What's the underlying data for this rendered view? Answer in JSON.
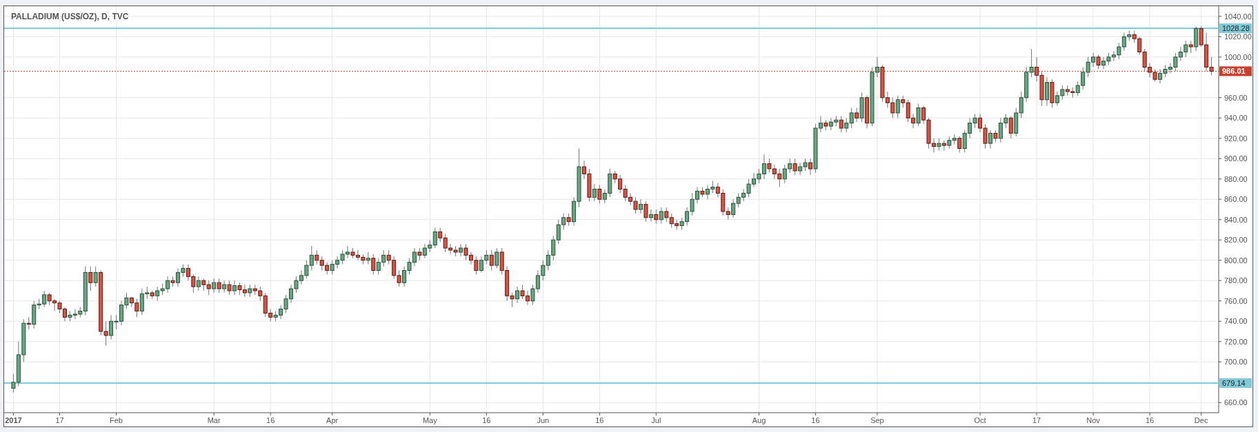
{
  "chart": {
    "chart_data": {
      "type": "candlestick",
      "title": "PALLADIUM (US$/OZ), D, TVC",
      "grid": true,
      "ylim": [
        650,
        1050
      ],
      "yticks": [
        {
          "value": 660,
          "label": "660.00"
        },
        {
          "value": 700,
          "label": "700.00"
        },
        {
          "value": 720,
          "label": "720.00"
        },
        {
          "value": 740,
          "label": "740.00"
        },
        {
          "value": 760,
          "label": "760.00"
        },
        {
          "value": 780,
          "label": "780.00"
        },
        {
          "value": 800,
          "label": "800.00"
        },
        {
          "value": 820,
          "label": "820.00"
        },
        {
          "value": 840,
          "label": "840.00"
        },
        {
          "value": 860,
          "label": "860.00"
        },
        {
          "value": 880,
          "label": "880.00"
        },
        {
          "value": 900,
          "label": "900.00"
        },
        {
          "value": 920,
          "label": "920.00"
        },
        {
          "value": 940,
          "label": "940.00"
        },
        {
          "value": 960,
          "label": "960.00"
        },
        {
          "value": 1000,
          "label": "1000.00"
        },
        {
          "value": 1020,
          "label": "1020.00"
        },
        {
          "value": 1040,
          "label": "1040.00"
        }
      ],
      "categories": [
        "2017",
        null,
        null,
        null,
        null,
        null,
        null,
        null,
        null,
        "17",
        null,
        null,
        null,
        null,
        null,
        null,
        null,
        null,
        null,
        null,
        "Feb",
        null,
        null,
        null,
        null,
        null,
        null,
        null,
        null,
        null,
        null,
        null,
        null,
        null,
        null,
        null,
        null,
        null,
        null,
        "Mar",
        null,
        null,
        null,
        null,
        null,
        null,
        null,
        null,
        null,
        null,
        "16",
        null,
        null,
        null,
        null,
        null,
        null,
        null,
        null,
        null,
        null,
        null,
        "Apr",
        null,
        null,
        null,
        null,
        null,
        null,
        null,
        null,
        null,
        null,
        null,
        null,
        null,
        null,
        null,
        null,
        null,
        null,
        "May",
        null,
        null,
        null,
        null,
        null,
        null,
        null,
        null,
        null,
        null,
        "16",
        null,
        null,
        null,
        null,
        null,
        null,
        null,
        null,
        null,
        null,
        "Jun",
        null,
        null,
        null,
        null,
        null,
        null,
        null,
        null,
        null,
        null,
        "16",
        null,
        null,
        null,
        null,
        null,
        null,
        null,
        null,
        null,
        null,
        "Jul",
        null,
        null,
        null,
        null,
        null,
        null,
        null,
        null,
        null,
        null,
        null,
        null,
        null,
        null,
        null,
        null,
        null,
        null,
        null,
        "Aug",
        null,
        null,
        null,
        null,
        null,
        null,
        null,
        null,
        null,
        null,
        "16",
        null,
        null,
        null,
        null,
        null,
        null,
        null,
        null,
        null,
        null,
        null,
        "Sep",
        null,
        null,
        null,
        null,
        null,
        null,
        null,
        null,
        null,
        null,
        null,
        null,
        null,
        null,
        null,
        null,
        null,
        null,
        null,
        "Oct",
        null,
        null,
        null,
        null,
        null,
        null,
        null,
        null,
        null,
        null,
        "17",
        null,
        null,
        null,
        null,
        null,
        null,
        null,
        null,
        null,
        null,
        "Nov",
        null,
        null,
        null,
        null,
        null,
        null,
        null,
        null,
        null,
        null,
        "16",
        null,
        null,
        null,
        null,
        null,
        null,
        null,
        null,
        null,
        "Dec",
        null,
        null
      ],
      "ohlc": [
        [
          674,
          688,
          670,
          680
        ],
        [
          680,
          720,
          676,
          707
        ],
        [
          707,
          742,
          700,
          738
        ],
        [
          738,
          744,
          732,
          737
        ],
        [
          737,
          760,
          733,
          756
        ],
        [
          756,
          762,
          752,
          757
        ],
        [
          757,
          770,
          754,
          766
        ],
        [
          766,
          768,
          756,
          760
        ],
        [
          760,
          762,
          750,
          758
        ],
        [
          758,
          760,
          748,
          752
        ],
        [
          752,
          754,
          740,
          744
        ],
        [
          744,
          750,
          740,
          746
        ],
        [
          746,
          752,
          742,
          747
        ],
        [
          747,
          754,
          744,
          750
        ],
        [
          750,
          794,
          746,
          788
        ],
        [
          788,
          794,
          770,
          778
        ],
        [
          778,
          794,
          774,
          788
        ],
        [
          788,
          790,
          726,
          730
        ],
        [
          730,
          740,
          716,
          726
        ],
        [
          726,
          746,
          722,
          740
        ],
        [
          740,
          746,
          732,
          740
        ],
        [
          740,
          760,
          736,
          756
        ],
        [
          756,
          768,
          752,
          763
        ],
        [
          763,
          764,
          754,
          758
        ],
        [
          758,
          762,
          744,
          750
        ],
        [
          750,
          772,
          746,
          767
        ],
        [
          767,
          774,
          762,
          768
        ],
        [
          768,
          770,
          762,
          765
        ],
        [
          765,
          774,
          760,
          770
        ],
        [
          770,
          777,
          766,
          772
        ],
        [
          772,
          784,
          768,
          780
        ],
        [
          780,
          784,
          774,
          778
        ],
        [
          778,
          792,
          774,
          788
        ],
        [
          788,
          796,
          784,
          792
        ],
        [
          792,
          796,
          780,
          784
        ],
        [
          784,
          786,
          768,
          774
        ],
        [
          774,
          784,
          770,
          780
        ],
        [
          780,
          782,
          770,
          776
        ],
        [
          776,
          780,
          766,
          772
        ],
        [
          772,
          782,
          768,
          778
        ],
        [
          778,
          782,
          768,
          772
        ],
        [
          772,
          780,
          768,
          776
        ],
        [
          776,
          780,
          766,
          770
        ],
        [
          770,
          780,
          766,
          775
        ],
        [
          775,
          778,
          766,
          771
        ],
        [
          771,
          776,
          764,
          768
        ],
        [
          768,
          776,
          764,
          772
        ],
        [
          772,
          776,
          766,
          770
        ],
        [
          770,
          774,
          760,
          765
        ],
        [
          765,
          768,
          744,
          748
        ],
        [
          748,
          752,
          740,
          744
        ],
        [
          744,
          750,
          740,
          746
        ],
        [
          746,
          756,
          742,
          752
        ],
        [
          752,
          766,
          748,
          762
        ],
        [
          762,
          776,
          758,
          772
        ],
        [
          772,
          784,
          768,
          780
        ],
        [
          780,
          790,
          776,
          785
        ],
        [
          785,
          800,
          782,
          795
        ],
        [
          795,
          814,
          790,
          805
        ],
        [
          805,
          810,
          796,
          800
        ],
        [
          800,
          804,
          790,
          795
        ],
        [
          795,
          798,
          786,
          790
        ],
        [
          790,
          800,
          786,
          796
        ],
        [
          796,
          804,
          792,
          800
        ],
        [
          800,
          810,
          796,
          806
        ],
        [
          806,
          814,
          802,
          808
        ],
        [
          808,
          812,
          802,
          805
        ],
        [
          805,
          810,
          800,
          803
        ],
        [
          803,
          806,
          796,
          800
        ],
        [
          800,
          808,
          796,
          802
        ],
        [
          802,
          806,
          786,
          790
        ],
        [
          790,
          802,
          786,
          798
        ],
        [
          798,
          810,
          794,
          805
        ],
        [
          805,
          810,
          796,
          800
        ],
        [
          800,
          804,
          782,
          785
        ],
        [
          785,
          790,
          774,
          778
        ],
        [
          778,
          794,
          774,
          790
        ],
        [
          790,
          802,
          786,
          798
        ],
        [
          798,
          812,
          794,
          808
        ],
        [
          808,
          812,
          800,
          805
        ],
        [
          805,
          816,
          802,
          812
        ],
        [
          812,
          820,
          808,
          815
        ],
        [
          815,
          832,
          812,
          828
        ],
        [
          828,
          832,
          818,
          822
        ],
        [
          822,
          826,
          808,
          812
        ],
        [
          812,
          816,
          806,
          810
        ],
        [
          810,
          814,
          804,
          808
        ],
        [
          808,
          816,
          804,
          812
        ],
        [
          812,
          816,
          800,
          805
        ],
        [
          805,
          808,
          796,
          800
        ],
        [
          800,
          804,
          786,
          790
        ],
        [
          790,
          804,
          788,
          800
        ],
        [
          800,
          810,
          796,
          805
        ],
        [
          805,
          810,
          790,
          795
        ],
        [
          795,
          812,
          792,
          808
        ],
        [
          808,
          812,
          786,
          790
        ],
        [
          790,
          794,
          760,
          765
        ],
        [
          765,
          768,
          754,
          762
        ],
        [
          762,
          774,
          758,
          770
        ],
        [
          770,
          776,
          762,
          765
        ],
        [
          765,
          770,
          756,
          760
        ],
        [
          760,
          776,
          756,
          772
        ],
        [
          772,
          790,
          768,
          785
        ],
        [
          785,
          800,
          780,
          795
        ],
        [
          795,
          810,
          790,
          805
        ],
        [
          805,
          824,
          800,
          820
        ],
        [
          820,
          840,
          816,
          835
        ],
        [
          835,
          846,
          830,
          842
        ],
        [
          842,
          846,
          834,
          838
        ],
        [
          838,
          862,
          834,
          858
        ],
        [
          858,
          910,
          852,
          892
        ],
        [
          892,
          898,
          880,
          885
        ],
        [
          885,
          890,
          858,
          862
        ],
        [
          862,
          875,
          858,
          870
        ],
        [
          870,
          874,
          856,
          860
        ],
        [
          860,
          870,
          856,
          866
        ],
        [
          866,
          890,
          862,
          885
        ],
        [
          885,
          888,
          876,
          880
        ],
        [
          880,
          884,
          866,
          870
        ],
        [
          870,
          874,
          858,
          862
        ],
        [
          862,
          866,
          854,
          858
        ],
        [
          858,
          862,
          846,
          850
        ],
        [
          850,
          860,
          846,
          855
        ],
        [
          855,
          858,
          838,
          842
        ],
        [
          842,
          850,
          838,
          845
        ],
        [
          845,
          850,
          836,
          840
        ],
        [
          840,
          852,
          836,
          848
        ],
        [
          848,
          852,
          838,
          842
        ],
        [
          842,
          846,
          832,
          836
        ],
        [
          836,
          840,
          830,
          834
        ],
        [
          834,
          842,
          830,
          838
        ],
        [
          838,
          852,
          834,
          848
        ],
        [
          848,
          866,
          844,
          860
        ],
        [
          860,
          872,
          856,
          868
        ],
        [
          868,
          872,
          862,
          865
        ],
        [
          865,
          874,
          860,
          870
        ],
        [
          870,
          878,
          866,
          872
        ],
        [
          872,
          876,
          862,
          866
        ],
        [
          866,
          870,
          844,
          848
        ],
        [
          848,
          852,
          840,
          845
        ],
        [
          845,
          860,
          842,
          856
        ],
        [
          856,
          866,
          852,
          862
        ],
        [
          862,
          870,
          858,
          866
        ],
        [
          866,
          880,
          862,
          875
        ],
        [
          875,
          886,
          872,
          880
        ],
        [
          880,
          890,
          876,
          885
        ],
        [
          885,
          904,
          880,
          895
        ],
        [
          895,
          900,
          886,
          890
        ],
        [
          890,
          894,
          880,
          885
        ],
        [
          885,
          890,
          872,
          880
        ],
        [
          880,
          894,
          876,
          890
        ],
        [
          890,
          900,
          886,
          895
        ],
        [
          895,
          900,
          884,
          888
        ],
        [
          888,
          896,
          884,
          892
        ],
        [
          892,
          900,
          888,
          896
        ],
        [
          896,
          900,
          884,
          890
        ],
        [
          890,
          934,
          886,
          930
        ],
        [
          930,
          942,
          926,
          935
        ],
        [
          935,
          938,
          928,
          932
        ],
        [
          932,
          940,
          928,
          936
        ],
        [
          936,
          942,
          932,
          938
        ],
        [
          938,
          942,
          926,
          930
        ],
        [
          930,
          940,
          926,
          935
        ],
        [
          935,
          950,
          930,
          945
        ],
        [
          945,
          950,
          936,
          940
        ],
        [
          940,
          965,
          936,
          960
        ],
        [
          960,
          962,
          930,
          935
        ],
        [
          935,
          990,
          932,
          985
        ],
        [
          985,
          1000,
          980,
          990
        ],
        [
          990,
          992,
          956,
          960
        ],
        [
          960,
          966,
          950,
          955
        ],
        [
          955,
          960,
          940,
          945
        ],
        [
          945,
          962,
          940,
          958
        ],
        [
          958,
          962,
          950,
          955
        ],
        [
          955,
          958,
          936,
          940
        ],
        [
          940,
          944,
          930,
          935
        ],
        [
          935,
          954,
          932,
          950
        ],
        [
          950,
          952,
          934,
          938
        ],
        [
          938,
          940,
          910,
          915
        ],
        [
          915,
          920,
          906,
          912
        ],
        [
          912,
          920,
          908,
          915
        ],
        [
          915,
          918,
          908,
          913
        ],
        [
          913,
          922,
          910,
          918
        ],
        [
          918,
          924,
          914,
          920
        ],
        [
          920,
          922,
          906,
          910
        ],
        [
          910,
          928,
          906,
          925
        ],
        [
          925,
          940,
          920,
          935
        ],
        [
          935,
          944,
          930,
          940
        ],
        [
          940,
          944,
          926,
          930
        ],
        [
          930,
          934,
          910,
          915
        ],
        [
          915,
          928,
          910,
          925
        ],
        [
          925,
          928,
          916,
          920
        ],
        [
          920,
          940,
          916,
          935
        ],
        [
          935,
          944,
          930,
          940
        ],
        [
          940,
          942,
          920,
          925
        ],
        [
          925,
          950,
          922,
          945
        ],
        [
          945,
          966,
          940,
          960
        ],
        [
          960,
          990,
          956,
          985
        ],
        [
          985,
          1008,
          980,
          990
        ],
        [
          990,
          1000,
          976,
          982
        ],
        [
          982,
          986,
          952,
          958
        ],
        [
          958,
          980,
          952,
          975
        ],
        [
          975,
          978,
          950,
          955
        ],
        [
          955,
          966,
          952,
          962
        ],
        [
          962,
          972,
          958,
          968
        ],
        [
          968,
          972,
          962,
          966
        ],
        [
          966,
          970,
          960,
          965
        ],
        [
          965,
          976,
          962,
          972
        ],
        [
          972,
          990,
          968,
          985
        ],
        [
          985,
          1000,
          980,
          995
        ],
        [
          995,
          1004,
          990,
          1000
        ],
        [
          1000,
          1002,
          988,
          992
        ],
        [
          992,
          1000,
          988,
          996
        ],
        [
          996,
          1004,
          992,
          1000
        ],
        [
          1000,
          1006,
          996,
          1002
        ],
        [
          1002,
          1014,
          998,
          1010
        ],
        [
          1010,
          1024,
          1006,
          1020
        ],
        [
          1020,
          1026,
          1016,
          1022
        ],
        [
          1022,
          1026,
          1014,
          1018
        ],
        [
          1018,
          1020,
          1002,
          1005
        ],
        [
          1005,
          1008,
          986,
          990
        ],
        [
          990,
          994,
          980,
          985
        ],
        [
          985,
          988,
          976,
          978
        ],
        [
          978,
          988,
          974,
          984
        ],
        [
          984,
          992,
          980,
          988
        ],
        [
          988,
          994,
          984,
          990
        ],
        [
          990,
          1004,
          986,
          1000
        ],
        [
          1000,
          1010,
          996,
          1005
        ],
        [
          1005,
          1016,
          1000,
          1012
        ],
        [
          1012,
          1016,
          1004,
          1010
        ],
        [
          1010,
          1030,
          1006,
          1028
        ],
        [
          1028,
          1030,
          1010,
          1012
        ],
        [
          1012,
          1024,
          986,
          990
        ],
        [
          990,
          1000,
          982,
          986
        ]
      ],
      "ref_lines": [
        {
          "axis": "y",
          "value": 1028.28,
          "label": "1028.28",
          "color": "#7fcbd9"
        },
        {
          "axis": "y",
          "value": 986.01,
          "label": "986.01",
          "color": "#c8402c"
        },
        {
          "axis": "y",
          "value": 679.14,
          "label": "679.14",
          "color": "#7fcbd9"
        }
      ]
    }
  }
}
